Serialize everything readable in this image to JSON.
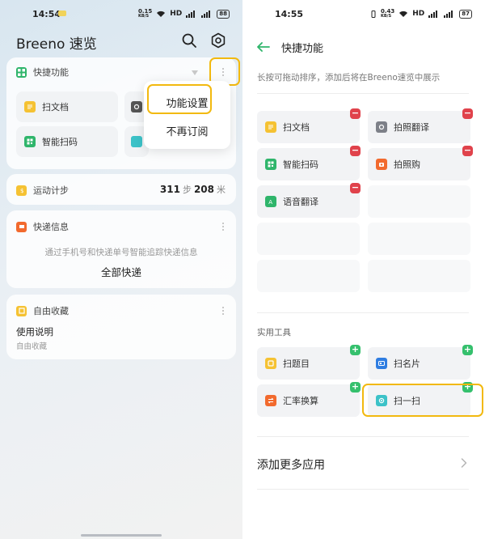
{
  "left": {
    "status": {
      "time": "14:54",
      "speed": "0.15",
      "speed_unit": "KB/S",
      "hd": "HD",
      "battery": "88"
    },
    "app_title": "Breeno 速览",
    "quick_card": {
      "title": "快捷功能",
      "tiles": [
        {
          "label": "扫文档",
          "icon": "document-scan-icon",
          "color": "#f5c233"
        },
        {
          "label": "智能扫码",
          "icon": "smart-scan-icon",
          "color": "#2fb56b"
        }
      ],
      "menu": {
        "item1": "功能设置",
        "item2": "不再订阅"
      }
    },
    "steps_card": {
      "label": "运动计步",
      "steps": "311",
      "steps_unit": "步",
      "distance": "208",
      "distance_unit": "米"
    },
    "express_card": {
      "title": "快递信息",
      "hint": "通过手机号和快递单号智能追踪快递信息",
      "action": "全部快递"
    },
    "fav_card": {
      "title": "自由收藏",
      "item_title": "使用说明",
      "item_sub": "自由收藏"
    }
  },
  "right": {
    "status": {
      "time": "14:55",
      "speed": "0.43",
      "speed_unit": "KB/S",
      "hd": "HD",
      "battery": "87"
    },
    "title": "快捷功能",
    "hint": "长按可拖动排序，添加后将在Breeno速览中展示",
    "added": [
      {
        "label": "扫文档",
        "icon": "document-scan-icon",
        "color": "#f5c233"
      },
      {
        "label": "拍照翻译",
        "icon": "photo-translate-icon",
        "color": "#7d8088"
      },
      {
        "label": "智能扫码",
        "icon": "smart-scan-icon",
        "color": "#2fb56b"
      },
      {
        "label": "拍照购",
        "icon": "photo-shop-icon",
        "color": "#f26a2e"
      },
      {
        "label": "语音翻译",
        "icon": "voice-translate-icon",
        "color": "#2fb56b"
      }
    ],
    "tools_label": "实用工具",
    "tools": [
      {
        "label": "扫题目",
        "icon": "question-scan-icon",
        "color": "#f5c233"
      },
      {
        "label": "扫名片",
        "icon": "card-scan-icon",
        "color": "#2f7de1"
      },
      {
        "label": "汇率换算",
        "icon": "currency-icon",
        "color": "#f26a2e"
      },
      {
        "label": "扫一扫",
        "icon": "scan-icon",
        "color": "#3cc2c8"
      }
    ],
    "more_apps": "添加更多应用"
  }
}
